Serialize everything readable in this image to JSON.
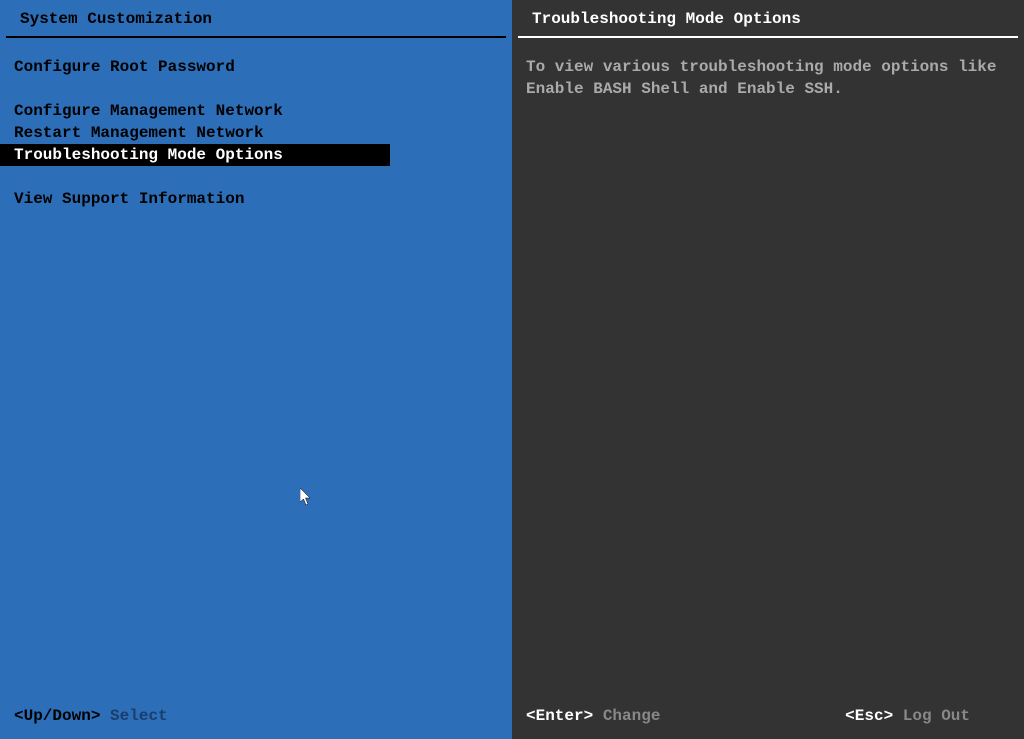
{
  "left": {
    "title": "System Customization",
    "groups": [
      [
        "Configure Root Password"
      ],
      [
        "Configure Management Network",
        "Restart Management Network",
        "Troubleshooting Mode Options"
      ],
      [
        "View Support Information"
      ]
    ],
    "selected": "Troubleshooting Mode Options",
    "footer": {
      "key": "<Up/Down>",
      "action": "Select"
    }
  },
  "right": {
    "title": "Troubleshooting Mode Options",
    "description": "To view various troubleshooting mode options like Enable BASH Shell and Enable SSH.",
    "footer": {
      "enter_key": "<Enter>",
      "enter_action": "Change",
      "esc_key": "<Esc>",
      "esc_action": "Log Out"
    }
  }
}
